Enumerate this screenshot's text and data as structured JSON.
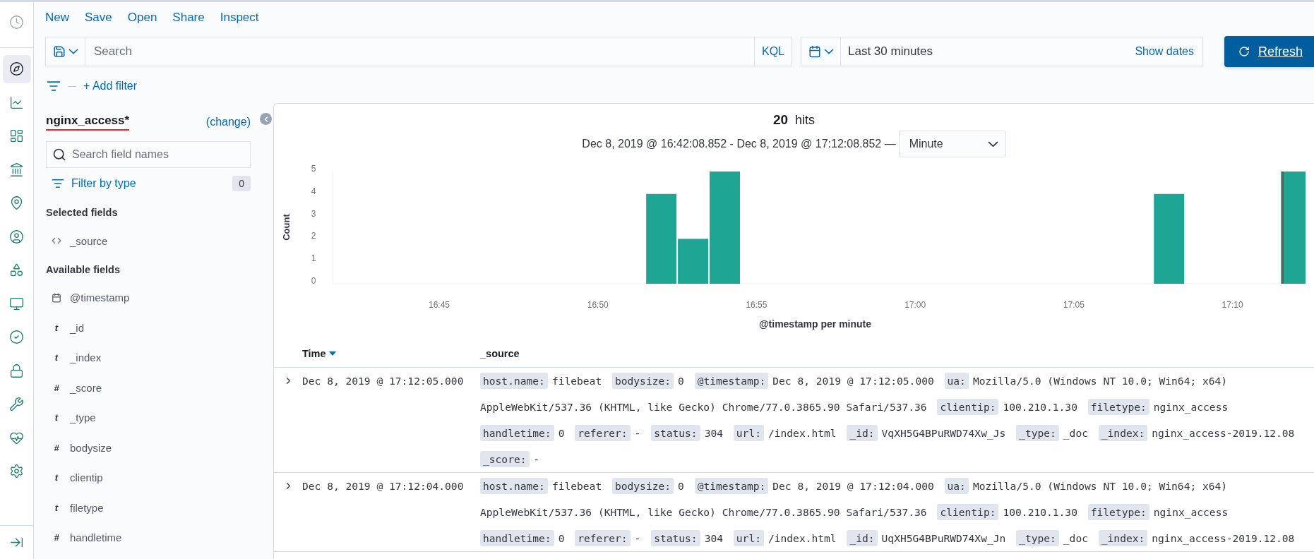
{
  "nav_rail": {
    "items": [
      {
        "kind": "clock",
        "selected": false
      },
      {
        "kind": "compass",
        "selected": true
      },
      {
        "kind": "chart",
        "selected": false
      },
      {
        "kind": "dashboard",
        "selected": false
      },
      {
        "kind": "canvas",
        "selected": false
      },
      {
        "kind": "map",
        "selected": false
      },
      {
        "kind": "user",
        "selected": false
      },
      {
        "kind": "shapes",
        "selected": false
      },
      {
        "kind": "monitor",
        "selected": false
      },
      {
        "kind": "check",
        "selected": false
      },
      {
        "kind": "lock",
        "selected": false
      },
      {
        "kind": "wrench",
        "selected": false
      },
      {
        "kind": "heart",
        "selected": false
      },
      {
        "kind": "gear",
        "selected": false
      },
      {
        "kind": "collapse",
        "selected": false
      }
    ]
  },
  "top_menu": [
    "New",
    "Save",
    "Open",
    "Share",
    "Inspect"
  ],
  "query": {
    "placeholder": "Search",
    "language": "KQL"
  },
  "time_picker": {
    "value": "Last 30 minutes",
    "show_dates": "Show dates"
  },
  "refresh": "Refresh",
  "filter_bar": {
    "add_filter": "+ Add filter"
  },
  "sidebar": {
    "index_pattern": "nginx_access*",
    "change": "(change)",
    "search_placeholder": "Search field names",
    "filter_label": "Filter by type",
    "filter_count": "0",
    "selected_heading": "Selected fields",
    "selected_fields": [
      {
        "kind": "code",
        "name": "_source"
      }
    ],
    "available_heading": "Available fields",
    "available_fields": [
      {
        "kind": "calendar",
        "name": "@timestamp"
      },
      {
        "kind": "glyph",
        "glyph": "t",
        "name": "_id"
      },
      {
        "kind": "glyph",
        "glyph": "t",
        "name": "_index"
      },
      {
        "kind": "glyph",
        "glyph": "#",
        "name": "_score"
      },
      {
        "kind": "glyph",
        "glyph": "t",
        "name": "_type"
      },
      {
        "kind": "glyph",
        "glyph": "#",
        "name": "bodysize"
      },
      {
        "kind": "glyph",
        "glyph": "t",
        "name": "clientip"
      },
      {
        "kind": "glyph",
        "glyph": "t",
        "name": "filetype"
      },
      {
        "kind": "glyph",
        "glyph": "#",
        "name": "handletime"
      }
    ]
  },
  "histogram": {
    "hit_count": "20",
    "hit_label": "hits",
    "range": "Dec 8, 2019 @ 16:42:08.852 - Dec 8, 2019 @ 17:12:08.852 —",
    "interval": "Minute",
    "chart_data": {
      "type": "bar",
      "xlabel": "@timestamp per minute",
      "ylabel": "Count",
      "categories": [
        null,
        null,
        null,
        "16:45",
        null,
        null,
        null,
        null,
        "16:50",
        null,
        null,
        null,
        null,
        "16:55",
        null,
        null,
        null,
        null,
        "17:00",
        null,
        null,
        null,
        null,
        "17:05",
        null,
        null,
        null,
        null,
        "17:10",
        null,
        null
      ],
      "series": [
        {
          "color": "#1ea593",
          "values": [
            null,
            null,
            null,
            null,
            null,
            null,
            null,
            null,
            null,
            null,
            4,
            2,
            5,
            null,
            null,
            null,
            null,
            null,
            null,
            null,
            null,
            null,
            null,
            null,
            null,
            null,
            4,
            null,
            null,
            null,
            5
          ]
        }
      ],
      "ylim": [
        0,
        5
      ],
      "yticks": [
        0,
        1,
        2,
        3,
        4,
        5
      ]
    }
  },
  "table": {
    "columns": [
      {
        "label": "Time",
        "sorted": true
      },
      {
        "label": "_source",
        "sorted": false
      }
    ],
    "rows": [
      {
        "time": "Dec 8, 2019 @ 17:12:05.000",
        "fields": [
          {
            "key": "host.name:",
            "value": "filebeat"
          },
          {
            "key": "bodysize:",
            "value": "0"
          },
          {
            "key": "@timestamp:",
            "value": "Dec 8, 2019 @ 17:12:05.000"
          },
          {
            "key": "ua:",
            "value": "Mozilla/5.0 (Windows NT 10.0; Win64; x64) AppleWebKit/537.36 (KHTML, like Gecko) Chrome/77.0.3865.90 Safari/537.36"
          },
          {
            "key": "clientip:",
            "value": "100.210.1.30"
          },
          {
            "key": "filetype:",
            "value": "nginx_access"
          },
          {
            "key": "handletime:",
            "value": "0"
          },
          {
            "key": "referer:",
            "value": "-"
          },
          {
            "key": "status:",
            "value": "304"
          },
          {
            "key": "url:",
            "value": "/index.html"
          },
          {
            "key": "_id:",
            "value": "VqXH5G4BPuRWD74Xw_Js"
          },
          {
            "key": "_type:",
            "value": "_doc"
          },
          {
            "key": "_index:",
            "value": "nginx_access-2019.12.08"
          },
          {
            "key": "_score:",
            "value": "-"
          }
        ]
      },
      {
        "time": "Dec 8, 2019 @ 17:12:04.000",
        "fields": [
          {
            "key": "host.name:",
            "value": "filebeat"
          },
          {
            "key": "bodysize:",
            "value": "0"
          },
          {
            "key": "@timestamp:",
            "value": "Dec 8, 2019 @ 17:12:04.000"
          },
          {
            "key": "ua:",
            "value": "Mozilla/5.0 (Windows NT 10.0; Win64; x64) AppleWebKit/537.36 (KHTML, like Gecko) Chrome/77.0.3865.90 Safari/537.36"
          },
          {
            "key": "clientip:",
            "value": "100.210.1.30"
          },
          {
            "key": "filetype:",
            "value": "nginx_access"
          },
          {
            "key": "handletime:",
            "value": "0"
          },
          {
            "key": "referer:",
            "value": "-"
          },
          {
            "key": "status:",
            "value": "304"
          },
          {
            "key": "url:",
            "value": "/index.html"
          },
          {
            "key": "_id:",
            "value": "UqXH5G4BPuRWD74Xw_Jn"
          },
          {
            "key": "_type:",
            "value": "_doc"
          },
          {
            "key": "_index:",
            "value": "nginx_access-2019.12.08"
          }
        ]
      }
    ]
  }
}
